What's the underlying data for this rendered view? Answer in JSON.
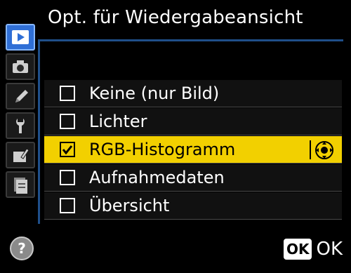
{
  "title": "Opt. für Wiedergabeansicht",
  "tabs": [
    {
      "icon": "playback-icon",
      "active": true
    },
    {
      "icon": "camera-icon",
      "active": false
    },
    {
      "icon": "pencil-icon",
      "active": false
    },
    {
      "icon": "wrench-icon",
      "active": false
    },
    {
      "icon": "retouch-icon",
      "active": false
    },
    {
      "icon": "recent-settings-icon",
      "active": false
    }
  ],
  "menu": {
    "items": [
      {
        "label": "Keine (nur Bild)",
        "checked": false,
        "selected": false
      },
      {
        "label": "Lichter",
        "checked": false,
        "selected": false
      },
      {
        "label": "RGB-Histogramm",
        "checked": true,
        "selected": true
      },
      {
        "label": "Aufnahmedaten",
        "checked": false,
        "selected": false
      },
      {
        "label": "Übersicht",
        "checked": false,
        "selected": false
      }
    ]
  },
  "help": {
    "label": "?"
  },
  "ok": {
    "box": "OK",
    "text": "OK"
  },
  "colors": {
    "highlight": "#f2d000",
    "tab_active": "#2f6fd6",
    "frame": "#1f4f8a"
  }
}
